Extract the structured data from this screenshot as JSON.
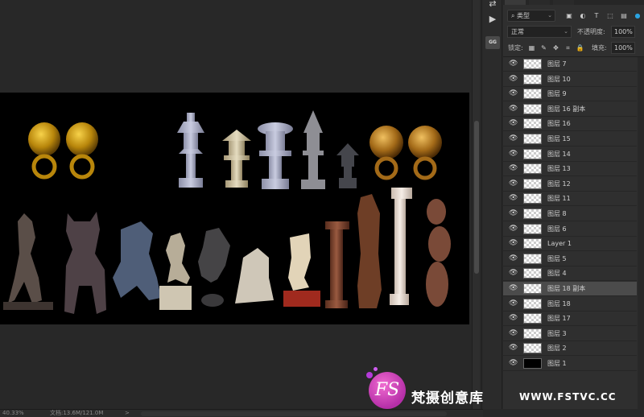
{
  "statusbar": {
    "zoom": "40.33%",
    "doc_info": "文档:13.6M/121.0M",
    "arrow": ">"
  },
  "layers_panel": {
    "kind_filter": "类型",
    "blend_mode": "正常",
    "opacity_label": "不透明度:",
    "opacity_value": "100%",
    "lock_label": "锁定:",
    "fill_label": "填充:",
    "fill_value": "100%",
    "layers": [
      {
        "name": "图层 7",
        "selected": false
      },
      {
        "name": "图层 10",
        "selected": false
      },
      {
        "name": "图层 9",
        "selected": false
      },
      {
        "name": "图层 16 副本",
        "selected": false
      },
      {
        "name": "图层 16",
        "selected": false
      },
      {
        "name": "图层 15",
        "selected": false
      },
      {
        "name": "图层 14",
        "selected": false
      },
      {
        "name": "图层 13",
        "selected": false
      },
      {
        "name": "图层 12",
        "selected": false
      },
      {
        "name": "图层 11",
        "selected": false
      },
      {
        "name": "图层 8",
        "selected": false
      },
      {
        "name": "图层 6",
        "selected": false
      },
      {
        "name": "Layer 1",
        "selected": false
      },
      {
        "name": "图层 5",
        "selected": false
      },
      {
        "name": "图层 4",
        "selected": false
      },
      {
        "name": "图层 18 副本",
        "selected": true
      },
      {
        "name": "图层 18",
        "selected": false
      },
      {
        "name": "图层 17",
        "selected": false
      },
      {
        "name": "图层 3",
        "selected": false
      },
      {
        "name": "图层 2",
        "selected": false
      },
      {
        "name": "图层 1",
        "selected": false
      }
    ]
  },
  "watermark": {
    "logo": "FS",
    "text": "梵摄创意库",
    "url": "WWW.FSTVC.CC"
  },
  "colors": {
    "canvas": "#000000",
    "workspace": "#282828",
    "panel": "#2f2f2f",
    "selected_layer": "#4b4b4b",
    "watermark_accent": "#d23fb8"
  }
}
